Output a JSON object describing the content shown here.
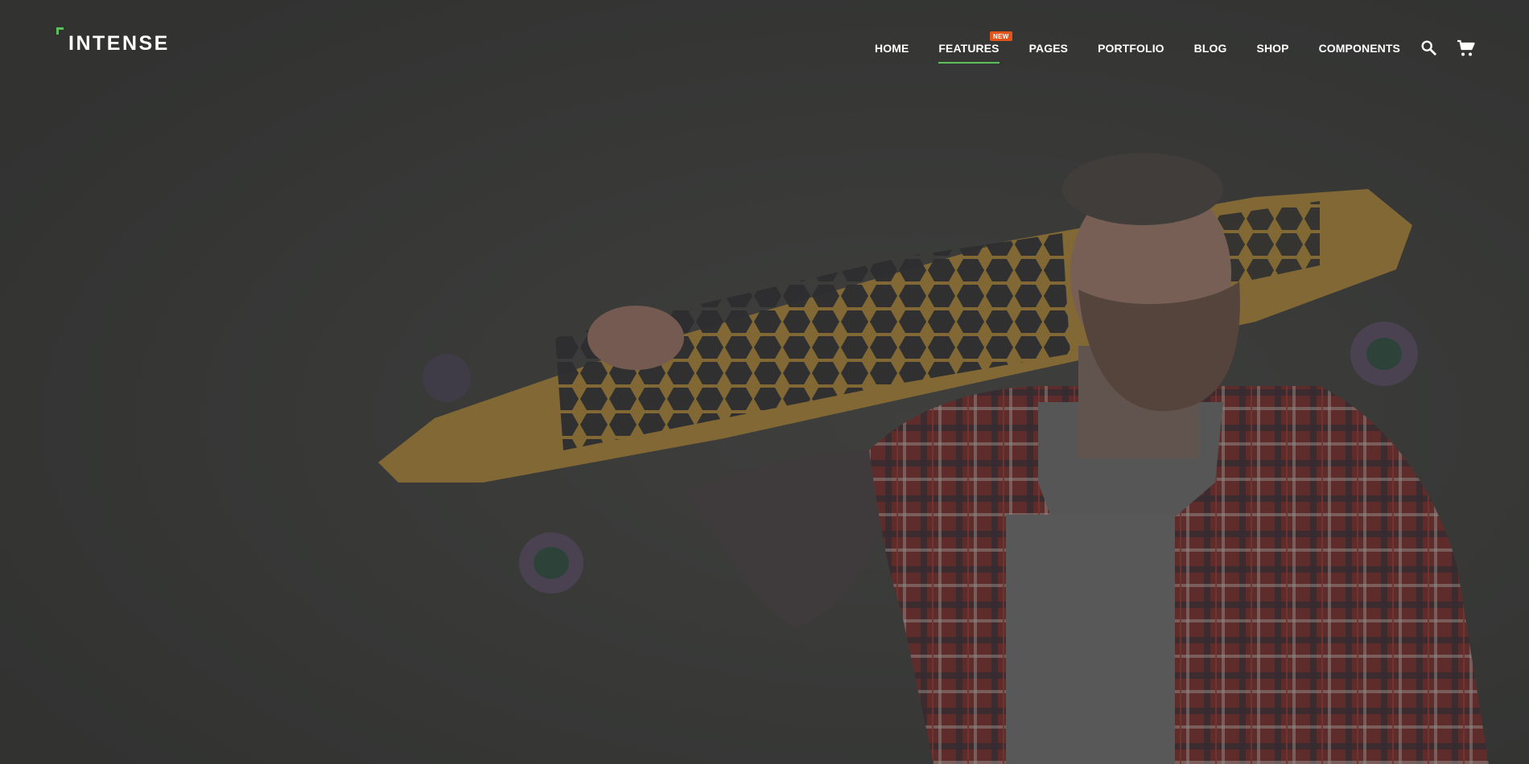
{
  "brand": {
    "name": "INTENSE",
    "accent_color": "#5cc15a"
  },
  "nav": {
    "items": [
      {
        "label": "HOME",
        "active": false
      },
      {
        "label": "FEATURES",
        "active": true,
        "badge": "NEW"
      },
      {
        "label": "PAGES",
        "active": false
      },
      {
        "label": "PORTFOLIO",
        "active": false
      },
      {
        "label": "BLOG",
        "active": false
      },
      {
        "label": "SHOP",
        "active": false
      },
      {
        "label": "COMPONENTS",
        "active": false
      }
    ],
    "badge_color": "#e2541c"
  },
  "icons": {
    "search": "search-icon",
    "cart": "cart-icon"
  },
  "hero": {
    "image": "bearded tattooed man in red plaid shirt holding a longboard skateboard over his shoulder"
  }
}
